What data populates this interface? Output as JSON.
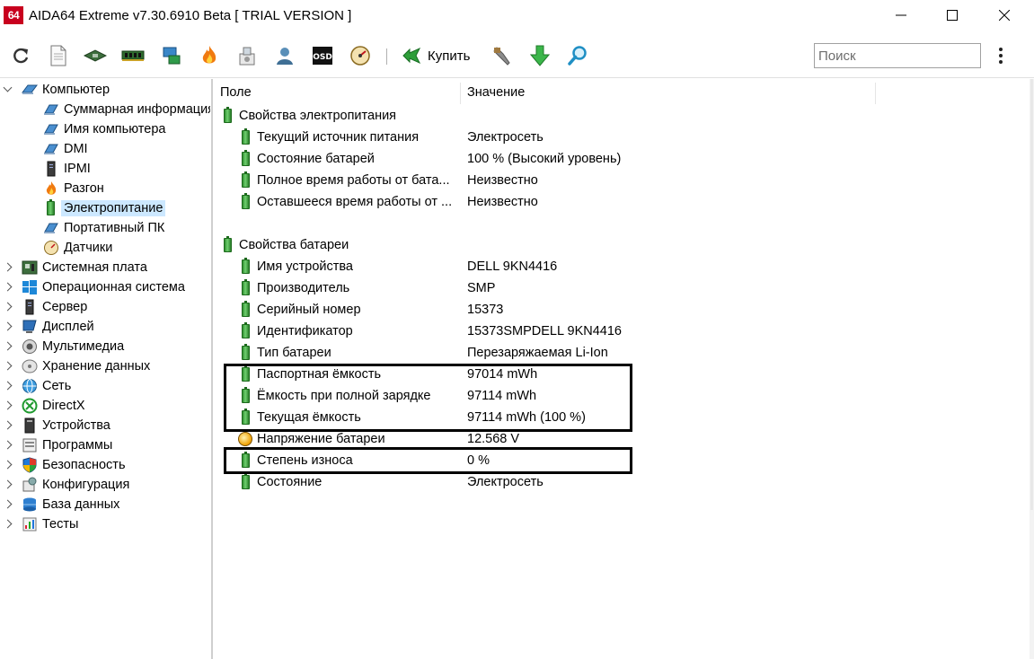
{
  "window": {
    "app_icon_text": "64",
    "title": "AIDA64 Extreme v7.30.6910 Beta  [ TRIAL VERSION ]"
  },
  "toolbar": {
    "buy_label": "Купить",
    "search_placeholder": "Поиск",
    "icons": [
      "refresh-icon",
      "report-icon",
      "motherboard-icon",
      "memory-icon",
      "network-icon",
      "flame-icon",
      "tools-icon",
      "user-icon",
      "osd-icon",
      "gauge-icon",
      "buy-icon",
      "wrench-icon",
      "download-icon",
      "search-icon"
    ]
  },
  "tree": {
    "root_label": "Компьютер",
    "children": [
      {
        "label": "Суммарная информация",
        "icon": "laptop-icon"
      },
      {
        "label": "Имя компьютера",
        "icon": "laptop-icon"
      },
      {
        "label": "DMI",
        "icon": "laptop-icon"
      },
      {
        "label": "IPMI",
        "icon": "server-icon"
      },
      {
        "label": "Разгон",
        "icon": "flame-icon"
      },
      {
        "label": "Электропитание",
        "icon": "battery-icon",
        "selected": true
      },
      {
        "label": "Портативный ПК",
        "icon": "laptop-icon"
      },
      {
        "label": "Датчики",
        "icon": "gauge-icon"
      }
    ],
    "categories": [
      {
        "label": "Системная плата",
        "icon": "motherboard-icon"
      },
      {
        "label": "Операционная система",
        "icon": "windows-icon"
      },
      {
        "label": "Сервер",
        "icon": "server-icon"
      },
      {
        "label": "Дисплей",
        "icon": "monitor-icon"
      },
      {
        "label": "Мультимедиа",
        "icon": "speaker-icon"
      },
      {
        "label": "Хранение данных",
        "icon": "disk-icon"
      },
      {
        "label": "Сеть",
        "icon": "network-icon"
      },
      {
        "label": "DirectX",
        "icon": "xbox-icon"
      },
      {
        "label": "Устройства",
        "icon": "devices-icon"
      },
      {
        "label": "Программы",
        "icon": "programs-icon"
      },
      {
        "label": "Безопасность",
        "icon": "shield-icon"
      },
      {
        "label": "Конфигурация",
        "icon": "config-icon"
      },
      {
        "label": "База данных",
        "icon": "database-icon"
      },
      {
        "label": "Тесты",
        "icon": "tests-icon"
      }
    ]
  },
  "table": {
    "col_field": "Поле",
    "col_value": "Значение",
    "power_section": {
      "title": "Свойства электропитания",
      "rows": [
        {
          "field": "Текущий источник питания",
          "value": "Электросеть"
        },
        {
          "field": "Состояние батарей",
          "value": "100 % (Высокий уровень)"
        },
        {
          "field": "Полное время работы от бата...",
          "value": "Неизвестно"
        },
        {
          "field": "Оставшееся время работы от ...",
          "value": "Неизвестно"
        }
      ]
    },
    "battery_section": {
      "title": "Свойства батареи",
      "rows": [
        {
          "field": "Имя устройства",
          "value": "DELL 9KN4416"
        },
        {
          "field": "Производитель",
          "value": "SMP"
        },
        {
          "field": "Серийный номер",
          "value": "15373"
        },
        {
          "field": "Идентификатор",
          "value": "15373SMPDELL 9KN4416"
        },
        {
          "field": "Тип батареи",
          "value": "Перезаряжаемая Li-Ion"
        },
        {
          "field": "Паспортная ёмкость",
          "value": "97014 mWh"
        },
        {
          "field": "Ёмкость при полной зарядке",
          "value": "97114 mWh"
        },
        {
          "field": "Текущая ёмкость",
          "value": "97114 mWh  (100 %)"
        },
        {
          "field": "Напряжение батареи",
          "value": "12.568 V"
        },
        {
          "field": "Степень износа",
          "value": "0 %"
        },
        {
          "field": "Состояние",
          "value": "Электросеть"
        }
      ]
    }
  }
}
